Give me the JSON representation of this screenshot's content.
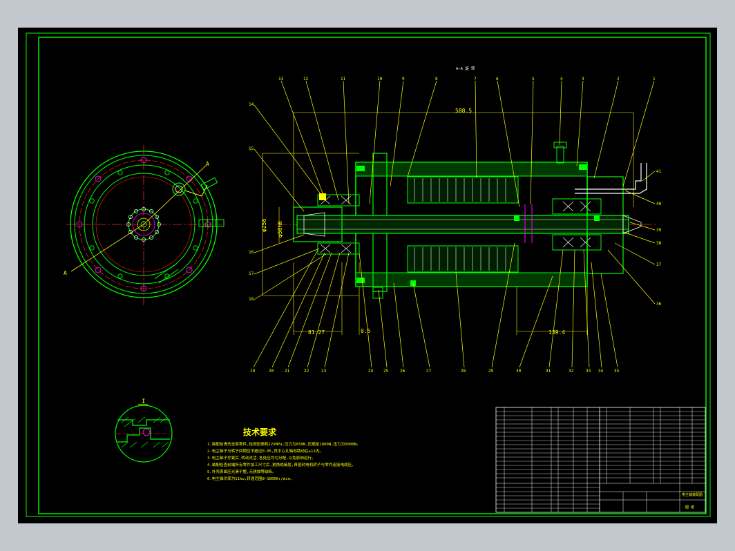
{
  "colors": {
    "background": "#c3c8cf",
    "sheet": "#000000",
    "frame": "#00ff00",
    "leader": "#ffff00",
    "dim": "#ffff00",
    "hatch": "#00ff00",
    "center": "#ff2020",
    "detail": "#ffffff",
    "secondary": "#00ffff",
    "accent": "#ff00ff"
  },
  "section_title": "A—A 旋 转",
  "view_marker": "A",
  "detail_marker": "I",
  "dimensions": {
    "overall_length": "588.5",
    "left_diameter": "φ50h6",
    "outer_diameter": "φ256",
    "front_length": "81.27",
    "shaft_gap": "0.5",
    "rear_length": "139.4"
  },
  "balloons_top": [
    "13",
    "12",
    "11",
    "10",
    "9",
    "8",
    "7",
    "6",
    "5",
    "4",
    "3",
    "2",
    "1"
  ],
  "balloons_left": [
    "14",
    "15",
    "16",
    "17",
    "18"
  ],
  "balloons_right": [
    "41",
    "40",
    "39",
    "38",
    "37",
    "36"
  ],
  "balloons_bottom": [
    "19",
    "20",
    "21",
    "22",
    "23",
    "24",
    "25",
    "26",
    "27",
    "28",
    "29",
    "30",
    "31",
    "32",
    "33",
    "34",
    "35"
  ],
  "notes": {
    "title": "技术要求",
    "lines": [
      "1.装配前清洗全部零件,检测压缩机125MPa,压力为650N,压缩至1800N,压力为5000N。",
      "2.电主轴子与转子间隙应不超过0.05,其中心孔轴向跳动在±12内。",
      "3.电主轴子拧紧后,转动灵活,各处应均匀分配,以免影响运行。",
      "4.装配检查前端所有零件加工尺寸后,更换绝缘层,再密封电机转子与零件连接电缆压。",
      "5.外壳表面应光滑平整,无锈蚀等缺陷。",
      "6.电主轴功率为11kw,转速范围8~18000r/min。"
    ]
  },
  "title_block": {
    "name_label": "电主轴装配图",
    "sheet_label": "图 纸"
  }
}
